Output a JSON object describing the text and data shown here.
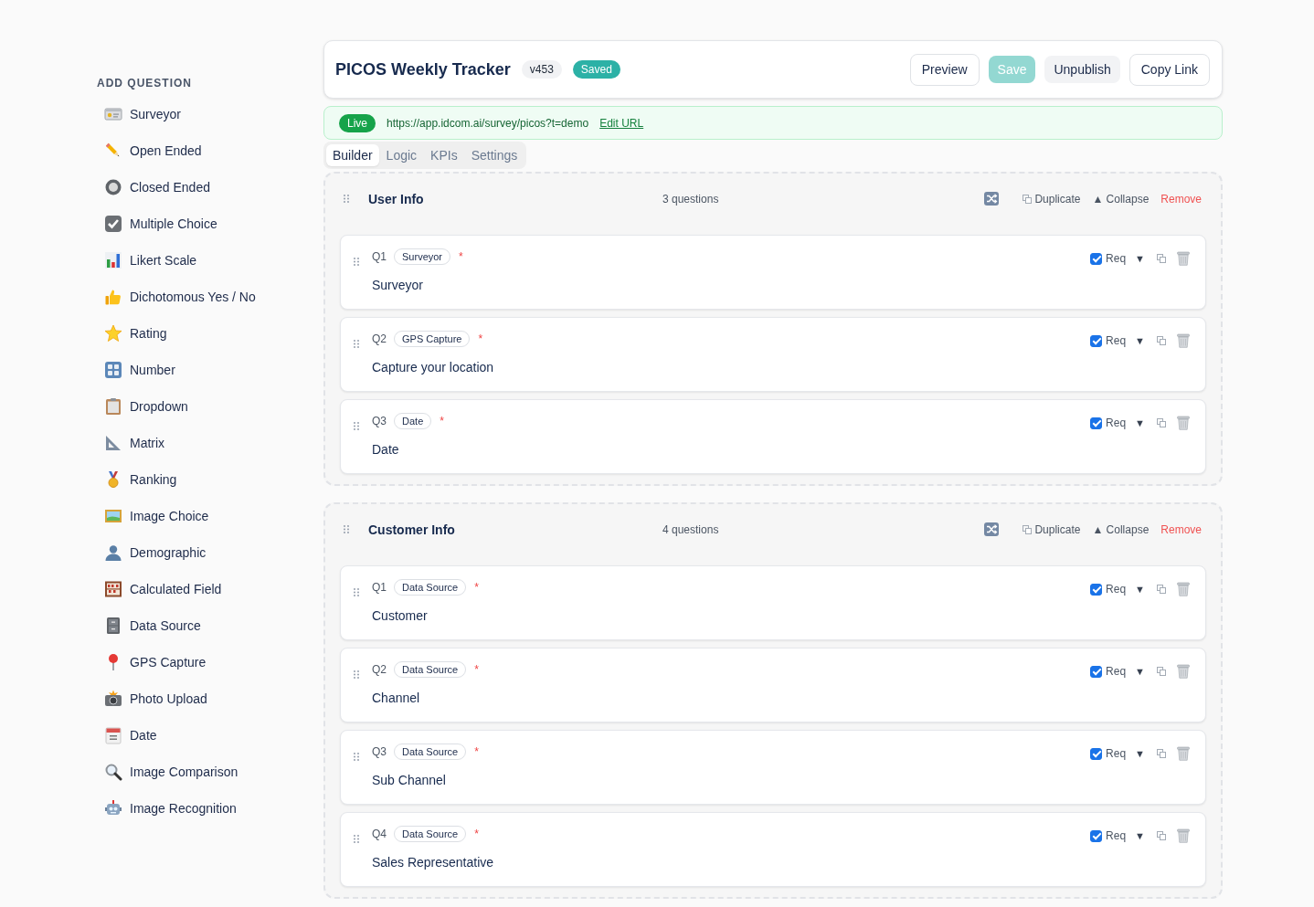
{
  "sidebar": {
    "heading": "ADD QUESTION",
    "items": [
      {
        "label": "Surveyor"
      },
      {
        "label": "Open Ended"
      },
      {
        "label": "Closed Ended"
      },
      {
        "label": "Multiple Choice"
      },
      {
        "label": "Likert Scale"
      },
      {
        "label": "Dichotomous Yes / No"
      },
      {
        "label": "Rating"
      },
      {
        "label": "Number"
      },
      {
        "label": "Dropdown"
      },
      {
        "label": "Matrix"
      },
      {
        "label": "Ranking"
      },
      {
        "label": "Image Choice"
      },
      {
        "label": "Demographic"
      },
      {
        "label": "Calculated Field"
      },
      {
        "label": "Data Source"
      },
      {
        "label": "GPS Capture"
      },
      {
        "label": "Photo Upload"
      },
      {
        "label": "Date"
      },
      {
        "label": "Image Comparison"
      },
      {
        "label": "Image Recognition"
      }
    ]
  },
  "header": {
    "title": "PICOS Weekly Tracker",
    "version": "v453",
    "status": "Saved",
    "buttons": [
      {
        "label": "Preview",
        "kind": "outline",
        "disabled": false
      },
      {
        "label": "Save",
        "kind": "primary",
        "disabled": true
      },
      {
        "label": "Unpublish",
        "kind": "soft",
        "disabled": false
      },
      {
        "label": "Copy Link",
        "kind": "outline",
        "disabled": false
      }
    ]
  },
  "publish_bar": {
    "status": "Live",
    "url": "https://app.idcom.ai/survey/picos?t=demo",
    "link": "Edit URL"
  },
  "tabs": [
    {
      "label": "Builder",
      "selected": true
    },
    {
      "label": "Logic",
      "selected": false
    },
    {
      "label": "KPIs",
      "selected": false
    },
    {
      "label": "Settings",
      "selected": false
    }
  ],
  "sections": [
    {
      "title": "User Info",
      "count": "3 questions",
      "duplicate": "Duplicate",
      "collapse": "▲ Collapse",
      "remove": "Remove",
      "questions": [
        {
          "number": "Q1",
          "type": "Surveyor",
          "required": true,
          "required_mark": "*",
          "title": "Surveyor",
          "required_label": "Req",
          "toggle": "▼"
        },
        {
          "number": "Q2",
          "type": "GPS Capture",
          "required": true,
          "required_mark": "*",
          "title": "Capture your location",
          "required_label": "Req",
          "toggle": "▼"
        },
        {
          "number": "Q3",
          "type": "Date",
          "required": true,
          "required_mark": "*",
          "title": "Date",
          "required_label": "Req",
          "toggle": "▼"
        }
      ]
    },
    {
      "title": "Customer Info",
      "count": "4 questions",
      "duplicate": "Duplicate",
      "collapse": "▲ Collapse",
      "remove": "Remove",
      "questions": [
        {
          "number": "Q1",
          "type": "Data Source",
          "required": true,
          "required_mark": "*",
          "title": "Customer",
          "required_label": "Req",
          "toggle": "▼"
        },
        {
          "number": "Q2",
          "type": "Data Source",
          "required": true,
          "required_mark": "*",
          "title": "Channel",
          "required_label": "Req",
          "toggle": "▼"
        },
        {
          "number": "Q3",
          "type": "Data Source",
          "required": true,
          "required_mark": "*",
          "title": "Sub Channel",
          "required_label": "Req",
          "toggle": "▼"
        },
        {
          "number": "Q4",
          "type": "Data Source",
          "required": true,
          "required_mark": "*",
          "title": "Sales Representative",
          "required_label": "Req",
          "toggle": "▼"
        }
      ]
    }
  ]
}
